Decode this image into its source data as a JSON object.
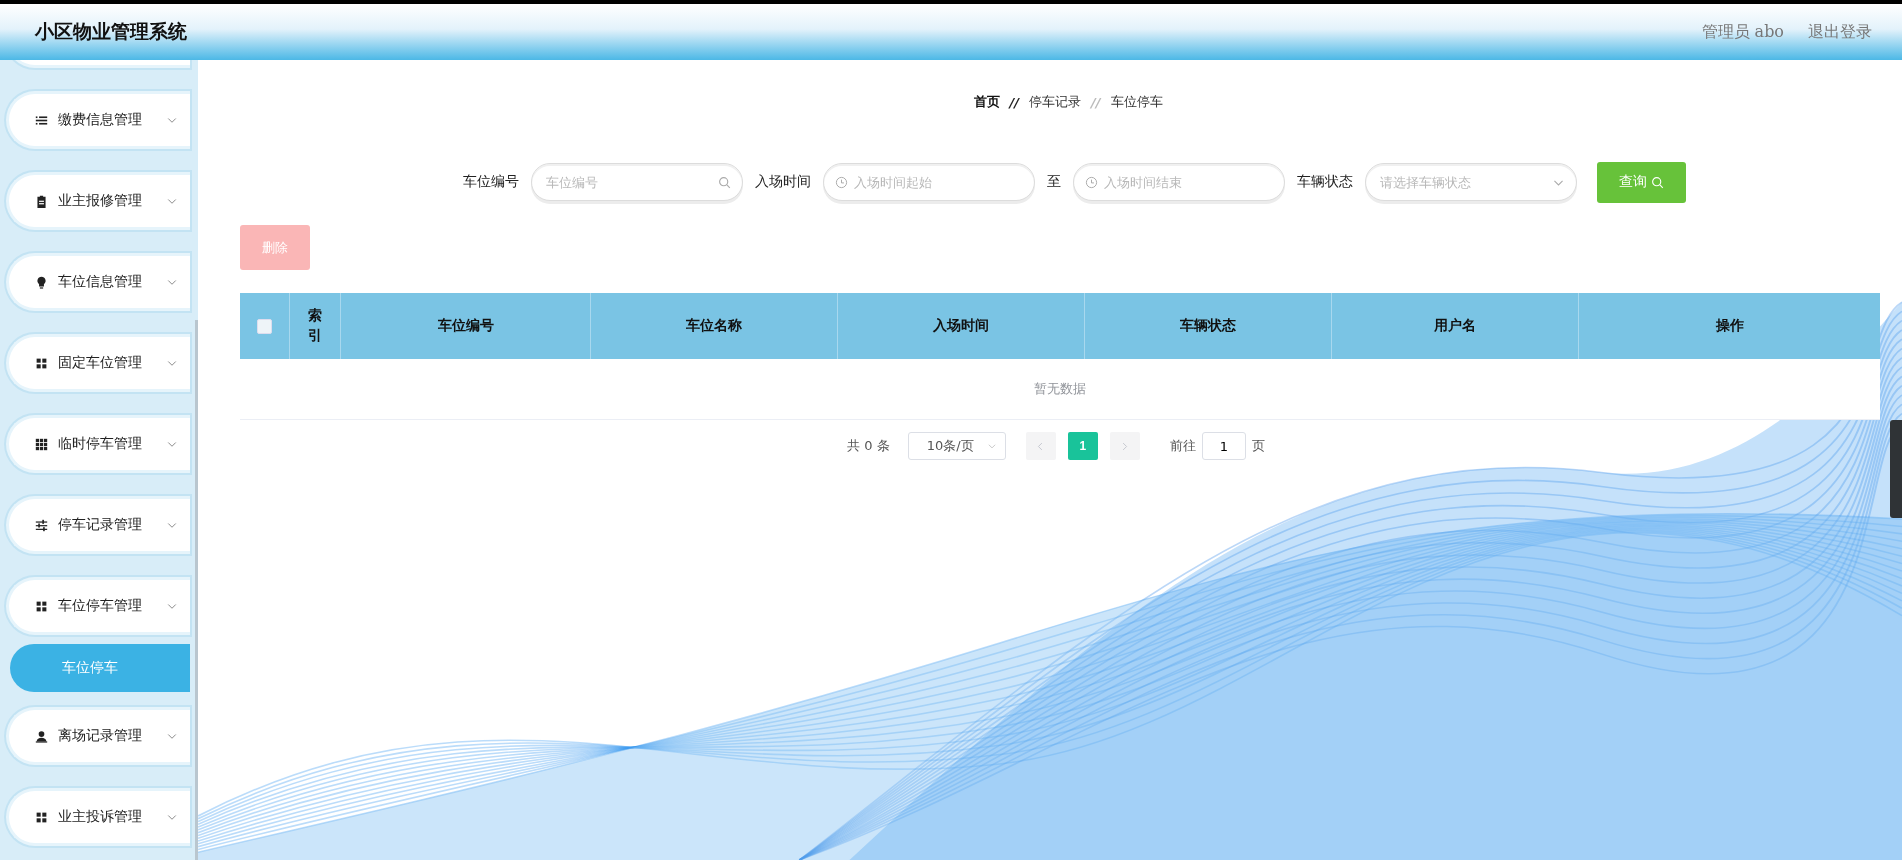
{
  "header": {
    "title": "小区物业管理系统",
    "user": "管理员 abo",
    "logout": "退出登录"
  },
  "sidebar": {
    "items": [
      {
        "label": "缴费信息管理",
        "kind": "list"
      },
      {
        "label": "业主报修管理",
        "kind": "clipboard"
      },
      {
        "label": "车位信息管理",
        "kind": "bulb"
      },
      {
        "label": "固定车位管理",
        "kind": "grid"
      },
      {
        "label": "临时停车管理",
        "kind": "dots"
      },
      {
        "label": "停车记录管理",
        "kind": "sliders"
      },
      {
        "label": "车位停车管理",
        "kind": "grid",
        "children": [
          {
            "label": "车位停车",
            "selected": true
          }
        ]
      },
      {
        "label": "离场记录管理",
        "kind": "person"
      },
      {
        "label": "业主投诉管理",
        "kind": "grid"
      }
    ]
  },
  "breadcrumb": [
    {
      "label": "首页"
    },
    {
      "separator": "//",
      "label": "停车记录"
    },
    {
      "separator": "//",
      "label": "车位停车"
    }
  ],
  "filters": [
    {
      "label": "车位编号",
      "placeholder": "车位编号",
      "kind": "search"
    },
    {
      "label": "入场时间",
      "placeholder": "入场时间起始",
      "kind": "date"
    },
    {
      "label": "至",
      "placeholder": "入场时间结束",
      "kind": "date"
    },
    {
      "label": "车辆状态",
      "placeholder": "请选择车辆状态",
      "kind": "select"
    }
  ],
  "query_button": "查询",
  "delete_button": {
    "label": "删除",
    "disabled": true
  },
  "table": {
    "select_all": false,
    "columns": [
      "索引",
      "车位编号",
      "车位名称",
      "入场时间",
      "车辆状态",
      "用户名",
      "操作"
    ],
    "empty_text": "暂无数据"
  },
  "pagination": {
    "total": "共 0 条",
    "page_size": "10条/页",
    "pages": [
      {
        "label": "1",
        "selected": true
      }
    ],
    "goto_label": "前往",
    "goto_value": "1",
    "goto_unit": "页"
  }
}
